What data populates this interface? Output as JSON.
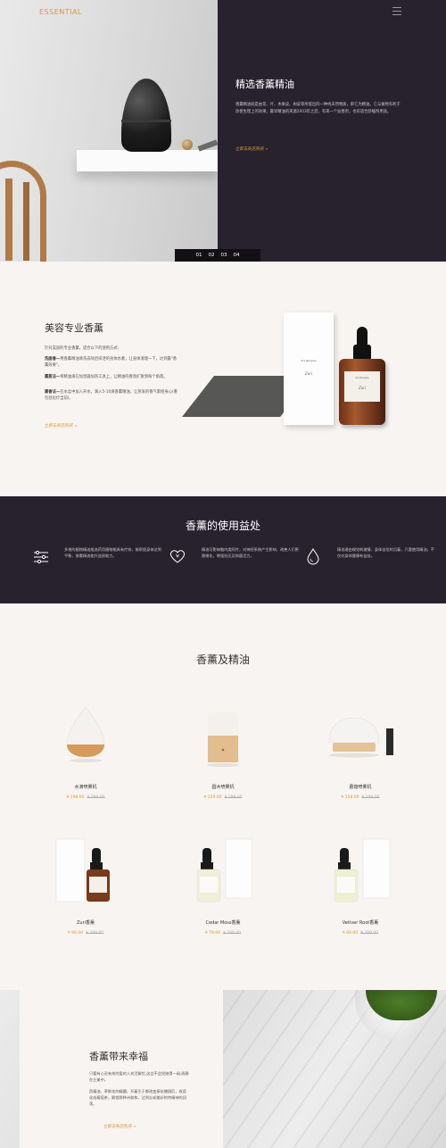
{
  "header": {
    "brand": "ESSENTIAL",
    "menu_icon": "menu-icon"
  },
  "hero": {
    "title": "精选香薰精油",
    "description": "香薰精油就是由花、叶、木果皮、树皮等所提出的一种纯天然物质，即它为精油。它与植物有利于改善生理上的效果。最早精油的来源2003年之后，有来一个益善剂，也有适合舒缓剂用途。",
    "link": "立即去商店购买 »",
    "pager": [
      "01",
      "02",
      "03",
      "04"
    ]
  },
  "beauty": {
    "title": "美容专业香薰",
    "intro": "针对美容的专业香薰，适合以下的使用方式:",
    "paragraphs": [
      {
        "lead": "洗面香—",
        "text": "用香薰精油清洗去除后排泄的身体水素，让身体清理一下，达到最\"香薰效果\"。"
      },
      {
        "lead": "薰蒸法—",
        "text": "将精油滴在加湿器加热工具上，让精油的香氛扩散到每个角落。"
      },
      {
        "lead": "熏香法—",
        "text": "在水盆中加入开水，滴入5-10滴香薰精油，让蒸发的香气萦绕身心(重包括化疗当前)。"
      }
    ],
    "link": "立即去商店购买 »",
    "box_brand": "Ars Recipes",
    "box_name": "Zuri",
    "bottle_brand": "Ars Recipes",
    "bottle_name": "Zuri"
  },
  "benefits": {
    "title": "香薰的使用益处",
    "items": [
      {
        "icon": "sliders-icon",
        "text": "多香的植物精油般选药用植物能具有疗效，能帮很身体达到平衡，香薰精油能升益质能力。"
      },
      {
        "icon": "heart-icon",
        "text": "精油可影响脑内类阿片，对神经系统产生影响，改善人们更稳绪化，增强抗压及抑菌活力。"
      },
      {
        "icon": "drop-icon",
        "text": "精油通由嗅觉刺激情、身体自信的沉着，只要使用精油，不仅对身体健康有益处。"
      }
    ]
  },
  "products": {
    "title": "香薰及精油",
    "items": [
      {
        "name": "水滴喷雾机",
        "price": "¥ 198.00",
        "old_price": "¥ 299.00"
      },
      {
        "name": "圆木喷雾机",
        "price": "¥ 229.00",
        "old_price": "¥ 299.00"
      },
      {
        "name": "蘑菇喷雾机",
        "price": "¥ 158.00",
        "old_price": "¥ 299.00"
      },
      {
        "name": "Zuri香薰",
        "price": "¥ 99.00",
        "old_price": "¥ 299.00"
      },
      {
        "name": "Cedar Moss香薰",
        "price": "¥ 79.00",
        "old_price": "¥ 299.00"
      },
      {
        "name": "Vetiver Root香薰",
        "price": "¥ 89.00",
        "old_price": "¥ 299.00"
      }
    ]
  },
  "happiness": {
    "title": "香薰带来幸福",
    "paragraphs": [
      "只要有心灵有关的爱的人充活解忧,这会不会觉她得一阀,再静在左美中。",
      "西精油、草鲜花的精髓，开着引于都改变接化播颁后，收获化成葡萄茶，解锁那种诗和和，达到忘却美好的特精神的回荡。"
    ],
    "link": "立即去商店购买 »"
  },
  "colors": {
    "accent": "#d79a33",
    "dark": "#28222e",
    "cream": "#f8f4f1"
  }
}
